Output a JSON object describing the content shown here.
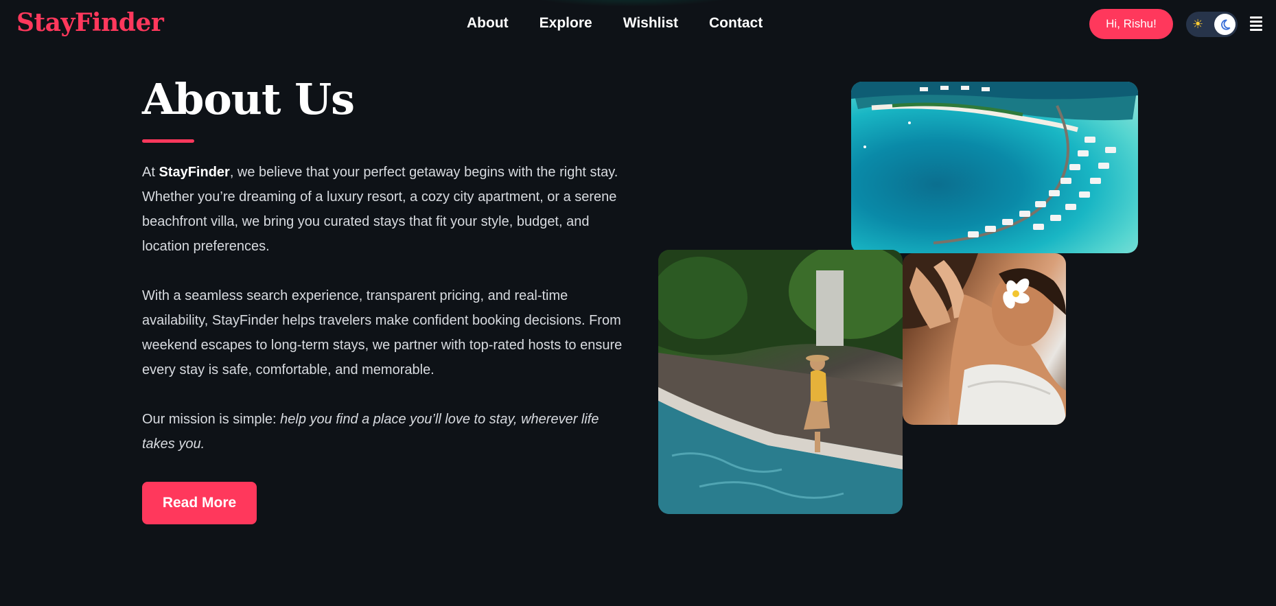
{
  "brand": {
    "name": "StayFinder",
    "accent": "#ff385c",
    "background": "#0e1217"
  },
  "nav": {
    "items": [
      {
        "label": "About"
      },
      {
        "label": "Explore"
      },
      {
        "label": "Wishlist"
      },
      {
        "label": "Contact"
      }
    ]
  },
  "header": {
    "greeting": "Hi, Rishu!",
    "theme_toggle": {
      "light_icon": "sun-icon",
      "dark_icon": "moon-icon",
      "mode": "dark"
    },
    "menu_icon": "menu-icon"
  },
  "about": {
    "title": "About Us",
    "p1_prefix": "At ",
    "p1_brand": "StayFinder",
    "p1_rest": ", we believe that your perfect getaway begins with the right stay. Whether you’re dreaming of a luxury resort, a cozy city apartment, or a serene beachfront villa, we bring you curated stays that fit your style, budget, and location preferences.",
    "p2": "With a seamless search experience, transparent pricing, and real-time availability, StayFinder helps travelers make confident booking decisions. From weekend escapes to long-term stays, we partner with top-rated hosts to ensure every stay is safe, comfortable, and memorable.",
    "p3_prefix": "Our mission is simple: ",
    "p3_italic": "help you find a place you’ll love to stay, wherever life takes you.",
    "cta": "Read More"
  },
  "gallery": {
    "images": [
      {
        "subject": "aerial view of island resort with overwater villas"
      },
      {
        "subject": "woman sitting at edge of pool in tropical garden"
      },
      {
        "subject": "woman with flower in hair receiving spa massage"
      }
    ]
  }
}
